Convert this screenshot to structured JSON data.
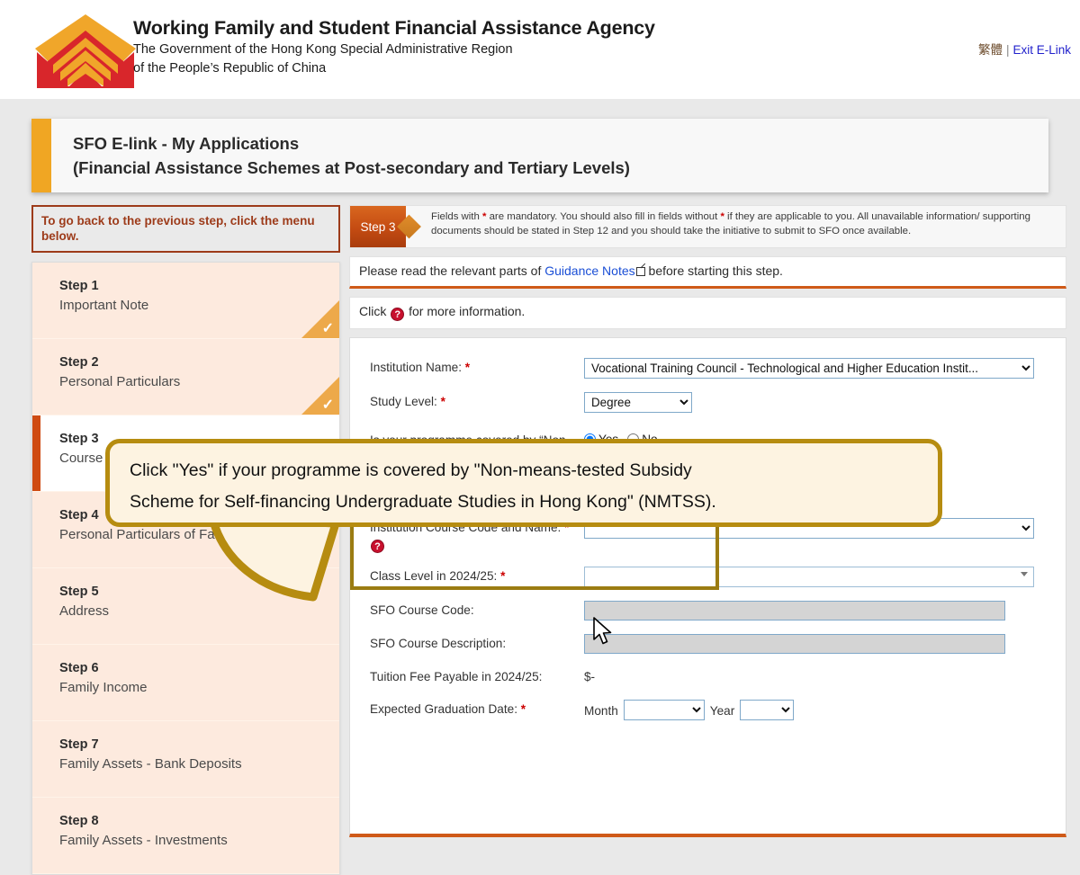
{
  "header": {
    "brand_title": "Working Family and Student Financial Assistance Agency",
    "brand_sub_line1": "The Government of the Hong Kong Special Administrative Region",
    "brand_sub_line2": "of the People’s Republic of China",
    "lang_link": "繁體",
    "separator": "|",
    "exit_link": "Exit E-Link",
    "logo_icon": "agency-diamond-logo"
  },
  "banner": {
    "line1": "SFO E-link - My Applications",
    "line2": "(Financial Assistance Schemes at Post-secondary and Tertiary Levels)",
    "accent_color": "#f0a623"
  },
  "sidebar": {
    "goback_notice": "To go back to the previous step, click the menu below.",
    "items": [
      {
        "num": "Step 1",
        "label": "Important Note",
        "state": "done"
      },
      {
        "num": "Step 2",
        "label": "Personal Particulars",
        "state": "done"
      },
      {
        "num": "Step 3",
        "label": "Course Information",
        "state": "active"
      },
      {
        "num": "Step 4",
        "label": "Personal Particulars of Family Member(s)",
        "state": "pending"
      },
      {
        "num": "Step 5",
        "label": "Address",
        "state": "pending"
      },
      {
        "num": "Step 6",
        "label": "Family Income",
        "state": "pending"
      },
      {
        "num": "Step 7",
        "label": "Family Assets - Bank Deposits",
        "state": "pending"
      },
      {
        "num": "Step 8",
        "label": "Family Assets - Investments",
        "state": "pending"
      }
    ],
    "done_check_glyph": "✓"
  },
  "main": {
    "step_badge": "Step 3",
    "notice_pre": "Fields with ",
    "notice_star1": "*",
    "notice_mid": " are mandatory. You should also fill in fields without ",
    "notice_star2": "*",
    "notice_post": " if they are applicable to you. All unavailable information/ supporting documents should be stated in Step 12 and you should take the initiative to submit to SFO once available.",
    "guidance_pre": "Please read the relevant parts of ",
    "guidance_link": "Guidance Notes",
    "guidance_post": " before starting this step.",
    "click_pre": "Click ",
    "click_post": " for more information.",
    "help_glyph": "?"
  },
  "form": {
    "institution_name": {
      "label": "Institution Name:",
      "required": "*",
      "value": "Vocational Training Council - Technological and Higher Education Instit..."
    },
    "study_level": {
      "label": "Study Level:",
      "required": "*",
      "value": "Degree"
    },
    "nmtss": {
      "label": "Is your programme covered by “Non-means-tested Subsidy Scheme for Self-financing Undergraduate Studies in Hong Kong” (NMTSS)?:",
      "required": "*",
      "option_yes": "Yes",
      "option_no": "No",
      "selected": "Yes"
    },
    "course_code": {
      "label": "Institution Course Code and Name:",
      "required": "*",
      "value": ""
    },
    "class_level": {
      "label": "Class Level in 2024/25:",
      "required": "*",
      "value": ""
    },
    "sfo_course_code": {
      "label": "SFO Course Code:",
      "value": ""
    },
    "sfo_course_desc": {
      "label": "SFO Course Description:",
      "value": ""
    },
    "tuition_fee": {
      "label": "Tuition Fee Payable in 2024/25:",
      "value": "$-"
    },
    "grad_date": {
      "label": "Expected Graduation Date:",
      "required": "*",
      "month_label": "Month",
      "month_value": "",
      "year_label": "Year",
      "year_value": ""
    }
  },
  "callout": {
    "line1": "Click \"Yes\" if your programme is covered by \"Non-means-tested Subsidy",
    "line2": "Scheme for Self-financing Undergraduate Studies in Hong Kong\" (NMTSS).",
    "border_color": "#b68c10",
    "fill_color": "#fdf3e1"
  },
  "highlight": {
    "color": "#9b7c12"
  }
}
